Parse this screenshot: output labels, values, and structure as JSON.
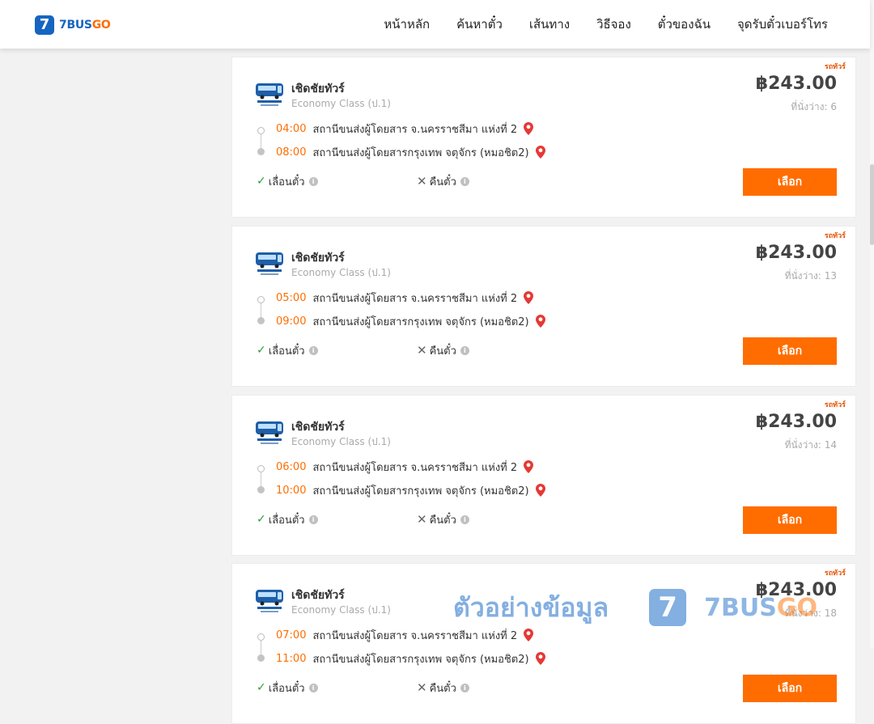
{
  "nav": {
    "logo_number": "7",
    "logo_text_main": "BUS",
    "logo_text_accent": "GO",
    "items": [
      "หน้าหลัก",
      "ค้นหาตั๋ว",
      "เส้นทาง",
      "วิธีจอง",
      "ตั๋วของฉัน",
      "จุดรับตั๋วเบอร์โทร"
    ]
  },
  "colors": {
    "accent": "#ff6d00",
    "brand": "#1565c0",
    "check": "#2e9d3a"
  },
  "trips": [
    {
      "tag": "รถทัวร์",
      "operator": "เชิดชัยทัวร์",
      "class": "Economy Class (ป.1)",
      "price": "฿243.00",
      "seats": "ที่นั่งว่าง: 6",
      "depart_time": "04:00",
      "depart_station": "สถานีขนส่งผู้โดยสาร จ.นครราชสีมา แห่งที่ 2",
      "arrive_time": "08:00",
      "arrive_station": "สถานีขนส่งผู้โดยสารกรุงเทพ จตุจักร (หมอชิต2)",
      "reschedule": "เลื่อนตั๋ว",
      "refund": "คืนตั๋ว",
      "button": "เลือก"
    },
    {
      "tag": "รถทัวร์",
      "operator": "เชิดชัยทัวร์",
      "class": "Economy Class (ป.1)",
      "price": "฿243.00",
      "seats": "ที่นั่งว่าง: 13",
      "depart_time": "05:00",
      "depart_station": "สถานีขนส่งผู้โดยสาร จ.นครราชสีมา แห่งที่ 2",
      "arrive_time": "09:00",
      "arrive_station": "สถานีขนส่งผู้โดยสารกรุงเทพ จตุจักร (หมอชิต2)",
      "reschedule": "เลื่อนตั๋ว",
      "refund": "คืนตั๋ว",
      "button": "เลือก"
    },
    {
      "tag": "รถทัวร์",
      "operator": "เชิดชัยทัวร์",
      "class": "Economy Class (ป.1)",
      "price": "฿243.00",
      "seats": "ที่นั่งว่าง: 14",
      "depart_time": "06:00",
      "depart_station": "สถานีขนส่งผู้โดยสาร จ.นครราชสีมา แห่งที่ 2",
      "arrive_time": "10:00",
      "arrive_station": "สถานีขนส่งผู้โดยสารกรุงเทพ จตุจักร (หมอชิต2)",
      "reschedule": "เลื่อนตั๋ว",
      "refund": "คืนตั๋ว",
      "button": "เลือก"
    },
    {
      "tag": "รถทัวร์",
      "operator": "เชิดชัยทัวร์",
      "class": "Economy Class (ป.1)",
      "price": "฿243.00",
      "seats": "ที่นั่งว่าง: 18",
      "depart_time": "07:00",
      "depart_station": "สถานีขนส่งผู้โดยสาร จ.นครราชสีมา แห่งที่ 2",
      "arrive_time": "11:00",
      "arrive_station": "สถานีขนส่งผู้โดยสารกรุงเทพ จตุจักร (หมอชิต2)",
      "reschedule": "เลื่อนตั๋ว",
      "refund": "คืนตั๋ว",
      "button": "เลือก"
    }
  ],
  "watermark": {
    "text": "ตัวอย่างข้อมูล",
    "badge": "7",
    "brand_main": "7BUS",
    "brand_accent": "GO"
  }
}
